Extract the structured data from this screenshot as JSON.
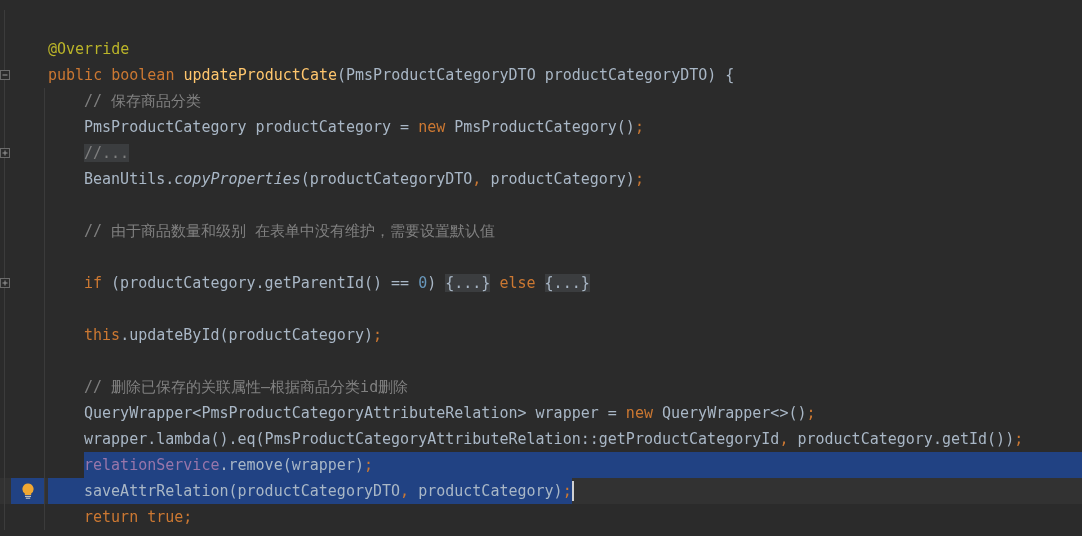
{
  "editor": {
    "lines": [
      {
        "selected": false,
        "current": false
      },
      {
        "selected": false,
        "current": false,
        "tokens": [
          {
            "kind": "annotation",
            "text": "@Override"
          }
        ]
      },
      {
        "selected": false,
        "current": false,
        "collapsed": false,
        "tokens": [
          {
            "kind": "keyword",
            "text": "public boolean "
          },
          {
            "kind": "method",
            "text": "updateProductCate"
          },
          {
            "kind": "plain",
            "text": "(PmsProductCategoryDTO productCategoryDTO) {"
          }
        ]
      },
      {
        "selected": false,
        "current": false,
        "indent": true,
        "tokens": [
          {
            "kind": "comment",
            "text": "// 保存商品分类"
          }
        ]
      },
      {
        "selected": false,
        "current": false,
        "indent": true,
        "tokens": [
          {
            "kind": "plain",
            "text": "PmsProductCategory productCategory = "
          },
          {
            "kind": "keyword",
            "text": "new"
          },
          {
            "kind": "plain",
            "text": " PmsProductCategory()"
          },
          {
            "kind": "punct",
            "text": ";"
          }
        ]
      },
      {
        "selected": false,
        "current": false,
        "indent": true,
        "collapsed": true,
        "tokens": [
          {
            "kind": "folded-comment",
            "text": "//..."
          }
        ]
      },
      {
        "selected": false,
        "current": false,
        "indent": true,
        "tokens": [
          {
            "kind": "plain",
            "text": "BeanUtils."
          },
          {
            "kind": "static",
            "text": "copyProperties"
          },
          {
            "kind": "plain",
            "text": "(productCategoryDTO"
          },
          {
            "kind": "punct",
            "text": ","
          },
          {
            "kind": "plain",
            "text": " productCategory)"
          },
          {
            "kind": "punct",
            "text": ";"
          }
        ]
      },
      {
        "selected": false,
        "current": false,
        "indent": true
      },
      {
        "selected": false,
        "current": false,
        "indent": true,
        "tokens": [
          {
            "kind": "comment",
            "text": "// 由于商品数量和级别 在表单中没有维护，需要设置默认值"
          }
        ]
      },
      {
        "selected": false,
        "current": false,
        "indent": true
      },
      {
        "selected": false,
        "current": false,
        "indent": true,
        "collapsed": true,
        "tokens": [
          {
            "kind": "keyword",
            "text": "if"
          },
          {
            "kind": "plain",
            "text": " (productCategory.getParentId() == "
          },
          {
            "kind": "number",
            "text": "0"
          },
          {
            "kind": "plain",
            "text": ") "
          },
          {
            "kind": "folded",
            "text": "{...}"
          },
          {
            "kind": "keyword",
            "text": " else "
          },
          {
            "kind": "folded",
            "text": "{...}"
          }
        ]
      },
      {
        "selected": false,
        "current": false,
        "indent": true
      },
      {
        "selected": false,
        "current": false,
        "indent": true,
        "tokens": [
          {
            "kind": "keyword",
            "text": "this"
          },
          {
            "kind": "plain",
            "text": ".updateById(productCategory)"
          },
          {
            "kind": "punct",
            "text": ";"
          }
        ]
      },
      {
        "selected": false,
        "current": false,
        "indent": true
      },
      {
        "selected": false,
        "current": false,
        "indent": true,
        "tokens": [
          {
            "kind": "comment",
            "text": "// 删除已保存的关联属性—根据商品分类id删除"
          }
        ]
      },
      {
        "selected": false,
        "current": false,
        "indent": true,
        "tokens": [
          {
            "kind": "plain",
            "text": "QueryWrapper<PmsProductCategoryAttributeRelation> wrapper = "
          },
          {
            "kind": "keyword",
            "text": "new"
          },
          {
            "kind": "plain",
            "text": " QueryWrapper<>()"
          },
          {
            "kind": "punct",
            "text": ";"
          }
        ]
      },
      {
        "selected": false,
        "current": false,
        "indent": true,
        "tokens": [
          {
            "kind": "plain",
            "text": "wrapper.lambda().eq(PmsProductCategoryAttributeRelation::getProductCategoryId"
          },
          {
            "kind": "punct",
            "text": ","
          },
          {
            "kind": "plain",
            "text": " productCategory.getId())"
          },
          {
            "kind": "punct",
            "text": ";"
          }
        ]
      },
      {
        "selected": true,
        "current": false,
        "indent": true,
        "tokens": [
          {
            "kind": "field",
            "text": "relationService"
          },
          {
            "kind": "plain",
            "text": ".remove(wrapper)"
          },
          {
            "kind": "punct",
            "text": ";"
          }
        ]
      },
      {
        "selected": true,
        "current": true,
        "indent": true,
        "bulb": true,
        "tokens": [
          {
            "kind": "plain",
            "text": "saveAttrRelation(productCategoryDTO"
          },
          {
            "kind": "punct",
            "text": ","
          },
          {
            "kind": "plain",
            "text": " productCategory)"
          },
          {
            "kind": "punct",
            "text": ";"
          }
        ]
      },
      {
        "selected": false,
        "current": false,
        "indent": true,
        "tokens": [
          {
            "kind": "keyword",
            "text": "return true"
          },
          {
            "kind": "punct",
            "text": ";"
          }
        ]
      }
    ]
  }
}
